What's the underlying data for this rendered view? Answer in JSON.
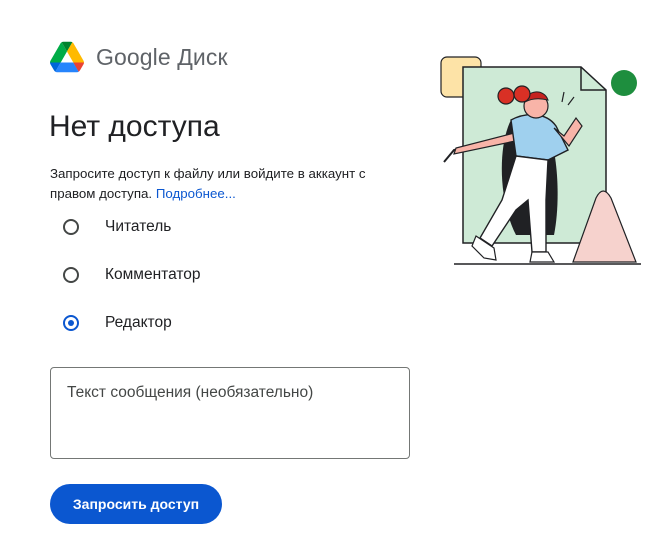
{
  "brand": {
    "name": "Google Диск",
    "logo_icon": "google-drive-logo-icon"
  },
  "page": {
    "title": "Нет доступа"
  },
  "description": {
    "text": "Запросите доступ к файлу или войдите в аккаунт с правом доступа.",
    "link_text": "Подробнее..."
  },
  "roles": [
    {
      "label": "Читатель",
      "selected": false
    },
    {
      "label": "Комментатор",
      "selected": false
    },
    {
      "label": "Редактор",
      "selected": true
    }
  ],
  "message": {
    "placeholder": "Текст сообщения (необязательно)",
    "value": ""
  },
  "button": {
    "label": "Запросить доступ"
  },
  "colors": {
    "primary": "#0b57d0",
    "text": "#202124",
    "muted": "#5f6368"
  },
  "illustration": {
    "icon": "person-running-from-document-illustration"
  }
}
